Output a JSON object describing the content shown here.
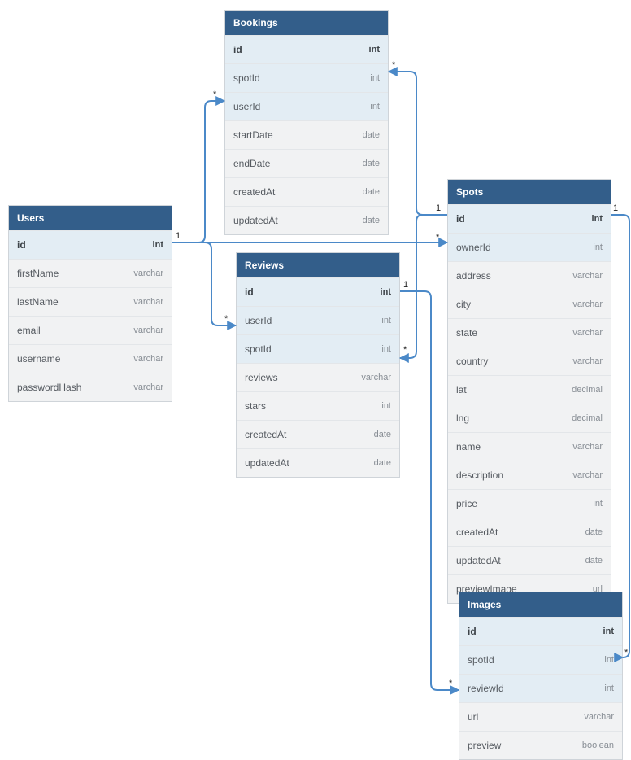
{
  "tables": {
    "users": {
      "title": "Users",
      "cols": [
        {
          "name": "id",
          "type": "int",
          "pk": true
        },
        {
          "name": "firstName",
          "type": "varchar"
        },
        {
          "name": "lastName",
          "type": "varchar"
        },
        {
          "name": "email",
          "type": "varchar"
        },
        {
          "name": "username",
          "type": "varchar"
        },
        {
          "name": "passwordHash",
          "type": "varchar"
        }
      ]
    },
    "bookings": {
      "title": "Bookings",
      "cols": [
        {
          "name": "id",
          "type": "int",
          "pk": true
        },
        {
          "name": "spotId",
          "type": "int",
          "fk": true
        },
        {
          "name": "userId",
          "type": "int",
          "fk": true
        },
        {
          "name": "startDate",
          "type": "date"
        },
        {
          "name": "endDate",
          "type": "date"
        },
        {
          "name": "createdAt",
          "type": "date"
        },
        {
          "name": "updatedAt",
          "type": "date"
        }
      ]
    },
    "reviews": {
      "title": "Reviews",
      "cols": [
        {
          "name": "id",
          "type": "int",
          "pk": true
        },
        {
          "name": "userId",
          "type": "int",
          "fk": true
        },
        {
          "name": "spotId",
          "type": "int",
          "fk": true
        },
        {
          "name": "reviews",
          "type": "varchar"
        },
        {
          "name": "stars",
          "type": "int"
        },
        {
          "name": "createdAt",
          "type": "date"
        },
        {
          "name": "updatedAt",
          "type": "date"
        }
      ]
    },
    "spots": {
      "title": "Spots",
      "cols": [
        {
          "name": "id",
          "type": "int",
          "pk": true
        },
        {
          "name": "ownerId",
          "type": "int",
          "fk": true
        },
        {
          "name": "address",
          "type": "varchar"
        },
        {
          "name": "city",
          "type": "varchar"
        },
        {
          "name": "state",
          "type": "varchar"
        },
        {
          "name": "country",
          "type": "varchar"
        },
        {
          "name": "lat",
          "type": "decimal"
        },
        {
          "name": "lng",
          "type": "decimal"
        },
        {
          "name": "name",
          "type": "varchar"
        },
        {
          "name": "description",
          "type": "varchar"
        },
        {
          "name": "price",
          "type": "int"
        },
        {
          "name": "createdAt",
          "type": "date"
        },
        {
          "name": "updatedAt",
          "type": "date"
        },
        {
          "name": "previewImage",
          "type": "url"
        }
      ]
    },
    "images": {
      "title": "Images",
      "cols": [
        {
          "name": "id",
          "type": "int",
          "pk": true
        },
        {
          "name": "spotId",
          "type": "int",
          "fk": true
        },
        {
          "name": "reviewId",
          "type": "int",
          "fk": true
        },
        {
          "name": "url",
          "type": "varchar"
        },
        {
          "name": "preview",
          "type": "boolean"
        }
      ]
    }
  },
  "relationships": [
    {
      "from": "Users.id",
      "to": "Bookings.userId",
      "card": "1:*"
    },
    {
      "from": "Users.id",
      "to": "Reviews.userId",
      "card": "1:*"
    },
    {
      "from": "Users.id",
      "to": "Spots.ownerId",
      "card": "1:*"
    },
    {
      "from": "Spots.id",
      "to": "Bookings.spotId",
      "card": "1:*"
    },
    {
      "from": "Spots.id",
      "to": "Reviews.spotId",
      "card": "1:*"
    },
    {
      "from": "Spots.id",
      "to": "Images.spotId",
      "card": "1:*"
    },
    {
      "from": "Reviews.id",
      "to": "Images.reviewId",
      "card": "1:*"
    }
  ],
  "cardinality_labels": {
    "one": "1",
    "many": "*"
  }
}
